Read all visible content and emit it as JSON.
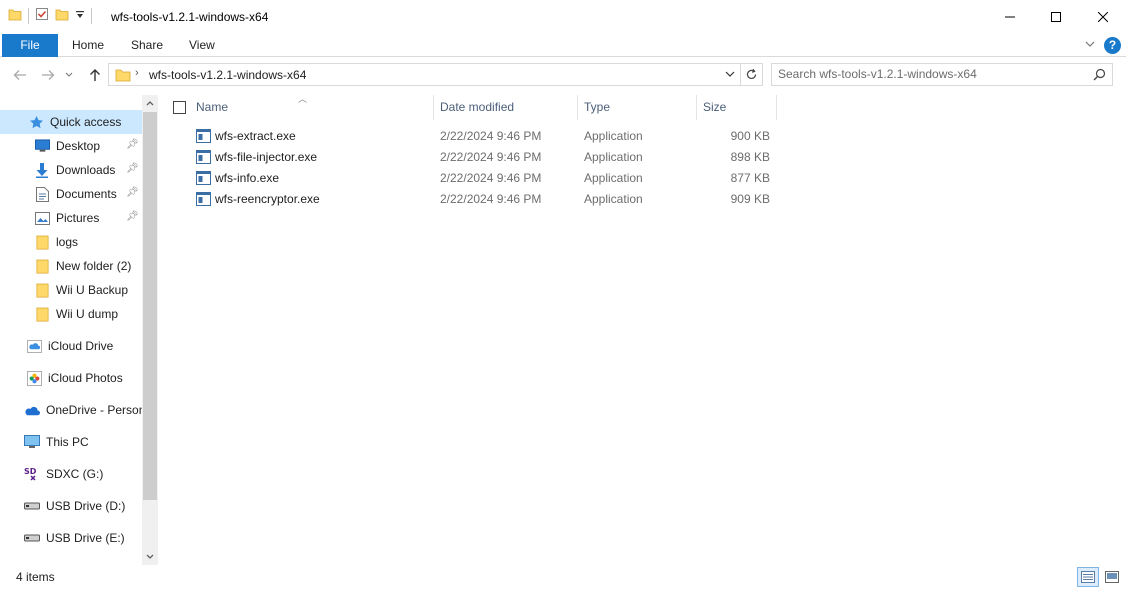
{
  "window": {
    "title": "wfs-tools-v1.2.1-windows-x64"
  },
  "ribbon": {
    "tabs": [
      "File",
      "Home",
      "Share",
      "View"
    ]
  },
  "address": {
    "path": "wfs-tools-v1.2.1-windows-x64"
  },
  "search": {
    "placeholder": "Search wfs-tools-v1.2.1-windows-x64"
  },
  "nav": {
    "items": [
      {
        "label": "Quick access",
        "icon": "star-icon",
        "selected": true
      },
      {
        "label": "Desktop",
        "icon": "desktop-icon",
        "pinned": true
      },
      {
        "label": "Downloads",
        "icon": "download-arrow-icon",
        "pinned": true
      },
      {
        "label": "Documents",
        "icon": "documents-icon",
        "pinned": true
      },
      {
        "label": "Pictures",
        "icon": "pictures-icon",
        "pinned": true
      },
      {
        "label": "logs",
        "icon": "folder-icon"
      },
      {
        "label": "New folder (2)",
        "icon": "folder-icon"
      },
      {
        "label": "Wii U Backup",
        "icon": "folder-icon"
      },
      {
        "label": "Wii U dump",
        "icon": "folder-icon"
      },
      {
        "label": "iCloud Drive",
        "icon": "icloud-drive-icon"
      },
      {
        "label": "iCloud Photos",
        "icon": "icloud-photos-icon"
      },
      {
        "label": "OneDrive - Personal",
        "icon": "onedrive-cloud-icon"
      },
      {
        "label": "This PC",
        "icon": "computer-icon"
      },
      {
        "label": "SDXC (G:)",
        "icon": "sd-card-icon"
      },
      {
        "label": "USB Drive (D:)",
        "icon": "usb-drive-icon"
      },
      {
        "label": "USB Drive (E:)",
        "icon": "usb-drive-icon"
      }
    ]
  },
  "columns": {
    "name": "Name",
    "date": "Date modified",
    "type": "Type",
    "size": "Size"
  },
  "files": [
    {
      "name": "wfs-extract.exe",
      "date": "2/22/2024 9:46 PM",
      "type": "Application",
      "size": "900 KB"
    },
    {
      "name": "wfs-file-injector.exe",
      "date": "2/22/2024 9:46 PM",
      "type": "Application",
      "size": "898 KB"
    },
    {
      "name": "wfs-info.exe",
      "date": "2/22/2024 9:46 PM",
      "type": "Application",
      "size": "877 KB"
    },
    {
      "name": "wfs-reencryptor.exe",
      "date": "2/22/2024 9:46 PM",
      "type": "Application",
      "size": "909 KB"
    }
  ],
  "status": {
    "count": "4 items"
  },
  "colors": {
    "accent": "#1979ca",
    "selection": "#cce8ff",
    "folder": "#ffd86a",
    "header_text": "#4c607a"
  }
}
